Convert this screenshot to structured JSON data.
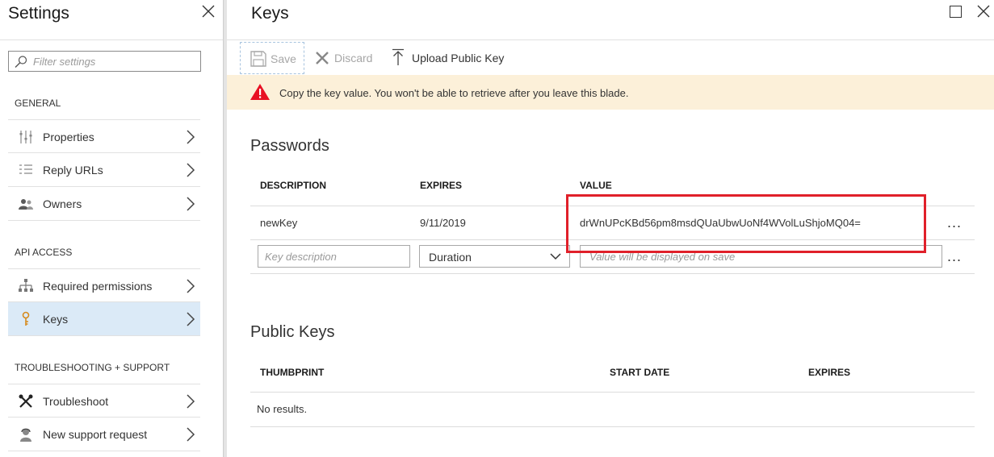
{
  "settings": {
    "title": "Settings",
    "filter_placeholder": "Filter settings",
    "sections": {
      "general": "GENERAL",
      "api_access": "API ACCESS",
      "troubleshooting": "TROUBLESHOOTING + SUPPORT"
    },
    "items": {
      "properties": "Properties",
      "reply_urls": "Reply URLs",
      "owners": "Owners",
      "required_permissions": "Required permissions",
      "keys": "Keys",
      "troubleshoot": "Troubleshoot",
      "new_support_request": "New support request"
    },
    "active_item": "Keys"
  },
  "keys_blade": {
    "title": "Keys",
    "toolbar": {
      "save": "Save",
      "discard": "Discard",
      "upload": "Upload Public Key"
    },
    "warning": "Copy the key value. You won't be able to retrieve after you leave this blade.",
    "passwords": {
      "heading": "Passwords",
      "columns": [
        "DESCRIPTION",
        "EXPIRES",
        "VALUE"
      ],
      "rows": [
        {
          "description": "newKey",
          "expires": "9/11/2019",
          "value": "drWnUPcKBd56pm8msdQUaUbwUoNf4WVolLuShjoMQ04="
        }
      ],
      "new_row": {
        "description_placeholder": "Key description",
        "duration_value": "Duration",
        "value_placeholder": "Value will be displayed on save"
      },
      "more": "..."
    },
    "public_keys": {
      "heading": "Public Keys",
      "columns": [
        "THUMBPRINT",
        "START DATE",
        "EXPIRES"
      ],
      "empty": "No results."
    }
  },
  "colors": {
    "active_item_bg": "#dbeaf7",
    "warning_bg": "#fcf0d9",
    "highlight_box": "#e0202a",
    "warning_icon": "#e81123"
  }
}
